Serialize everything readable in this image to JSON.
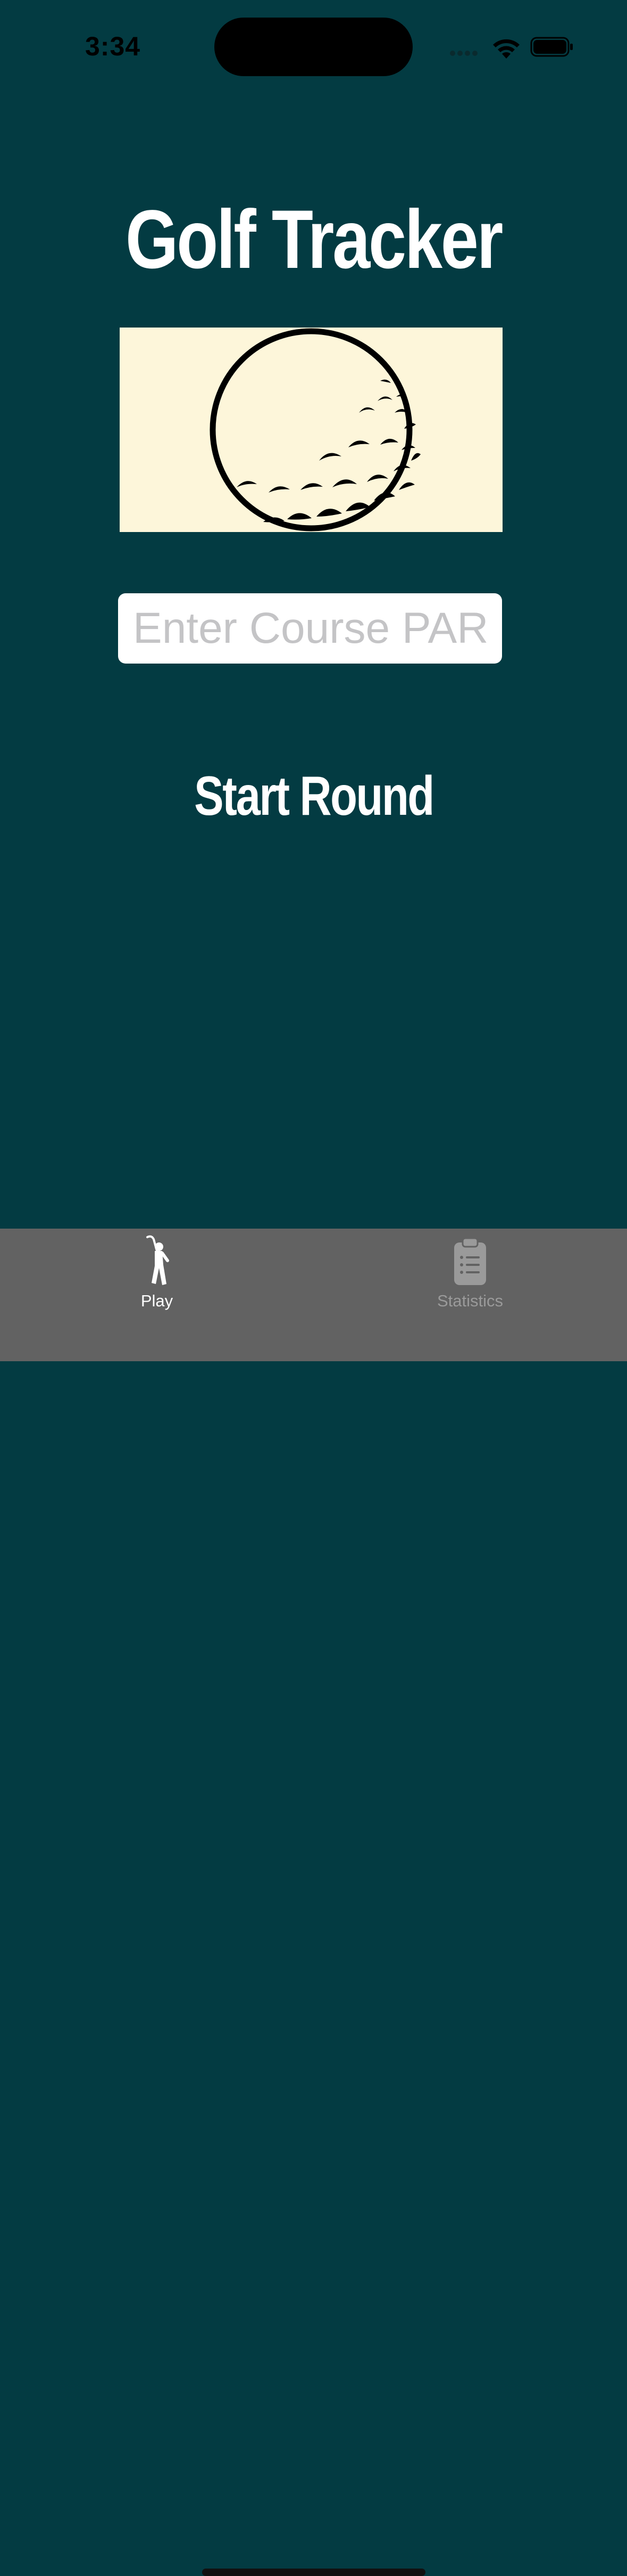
{
  "status_bar": {
    "time": "3:34",
    "icons": [
      "cellular-signal-icon",
      "wifi-icon",
      "battery-icon"
    ]
  },
  "colors": {
    "background": "#033b42",
    "hero_background": "#fdf6da",
    "tab_bar": "#626262",
    "tab_active": "#ffffff",
    "tab_inactive": "#9a9a9a"
  },
  "main": {
    "title": "Golf Tracker",
    "hero_icon": "golf-ball-icon",
    "par_input": {
      "placeholder": "Enter Course PAR",
      "value": ""
    },
    "start_button_label": "Start Round"
  },
  "tab_bar": {
    "tabs": [
      {
        "label": "Play",
        "icon": "golfer-icon",
        "active": true
      },
      {
        "label": "Statistics",
        "icon": "clipboard-list-icon",
        "active": false
      }
    ]
  }
}
